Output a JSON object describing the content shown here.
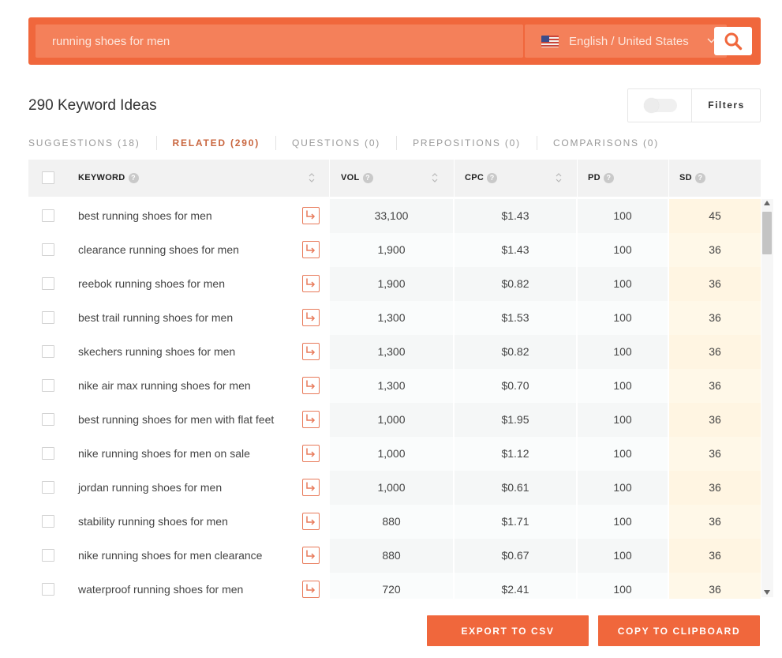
{
  "search": {
    "query": "running shoes for men",
    "language": "English / United States",
    "chevron": "chevron-down-icon",
    "button_icon": "search-icon"
  },
  "results": {
    "title": "290 Keyword Ideas",
    "filters_label": "Filters"
  },
  "tabs": [
    {
      "label": "SUGGESTIONS (18)",
      "active": false
    },
    {
      "label": "RELATED (290)",
      "active": true
    },
    {
      "label": "QUESTIONS (0)",
      "active": false
    },
    {
      "label": "PREPOSITIONS (0)",
      "active": false
    },
    {
      "label": "COMPARISONS (0)",
      "active": false
    }
  ],
  "table": {
    "headers": {
      "keyword": "KEYWORD",
      "vol": "VOL",
      "cpc": "CPC",
      "pd": "PD",
      "sd": "SD"
    },
    "rows": [
      {
        "keyword": "best running shoes for men",
        "vol": "33,100",
        "cpc": "$1.43",
        "pd": "100",
        "sd": "45"
      },
      {
        "keyword": "clearance running shoes for men",
        "vol": "1,900",
        "cpc": "$1.43",
        "pd": "100",
        "sd": "36"
      },
      {
        "keyword": "reebok running shoes for men",
        "vol": "1,900",
        "cpc": "$0.82",
        "pd": "100",
        "sd": "36"
      },
      {
        "keyword": "best trail running shoes for men",
        "vol": "1,300",
        "cpc": "$1.53",
        "pd": "100",
        "sd": "36"
      },
      {
        "keyword": "skechers running shoes for men",
        "vol": "1,300",
        "cpc": "$0.82",
        "pd": "100",
        "sd": "36"
      },
      {
        "keyword": "nike air max running shoes for men",
        "vol": "1,300",
        "cpc": "$0.70",
        "pd": "100",
        "sd": "36"
      },
      {
        "keyword": "best running shoes for men with flat feet",
        "vol": "1,000",
        "cpc": "$1.95",
        "pd": "100",
        "sd": "36"
      },
      {
        "keyword": "nike running shoes for men on sale",
        "vol": "1,000",
        "cpc": "$1.12",
        "pd": "100",
        "sd": "36"
      },
      {
        "keyword": "jordan running shoes for men",
        "vol": "1,000",
        "cpc": "$0.61",
        "pd": "100",
        "sd": "36"
      },
      {
        "keyword": "stability running shoes for men",
        "vol": "880",
        "cpc": "$1.71",
        "pd": "100",
        "sd": "36"
      },
      {
        "keyword": "nike running shoes for men clearance",
        "vol": "880",
        "cpc": "$0.67",
        "pd": "100",
        "sd": "36"
      },
      {
        "keyword": "waterproof running shoes for men",
        "vol": "720",
        "cpc": "$2.41",
        "pd": "100",
        "sd": "36"
      }
    ]
  },
  "actions": {
    "export": "EXPORT TO CSV",
    "copy": "COPY TO CLIPBOARD"
  },
  "colors": {
    "accent": "#f0673c",
    "input_bg": "#f4805a",
    "active_tab": "#c9663f",
    "sd_column": "#fff8e8"
  }
}
